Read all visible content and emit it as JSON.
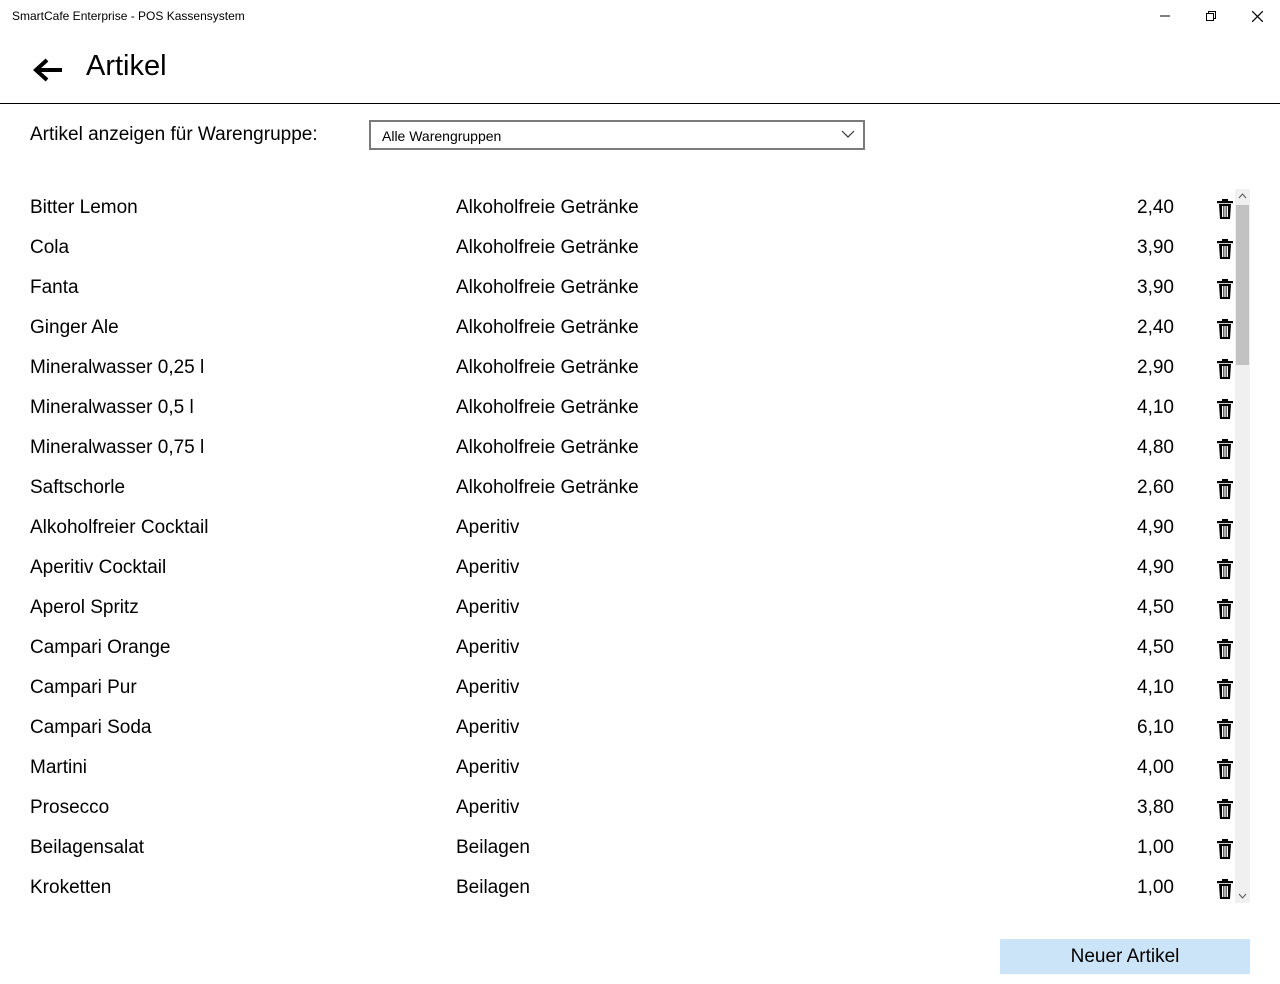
{
  "window": {
    "title": "SmartCafe Enterprise - POS Kassensystem"
  },
  "header": {
    "back_icon": "arrow-left-icon",
    "title": "Artikel"
  },
  "filter": {
    "label": "Artikel anzeigen für Warengruppe:",
    "selected": "Alle Warengruppen"
  },
  "articles": [
    {
      "name": "Bitter Lemon",
      "group": "Alkoholfreie Getränke",
      "price": "2,40"
    },
    {
      "name": "Cola",
      "group": "Alkoholfreie Getränke",
      "price": "3,90"
    },
    {
      "name": "Fanta",
      "group": "Alkoholfreie Getränke",
      "price": "3,90"
    },
    {
      "name": "Ginger Ale",
      "group": "Alkoholfreie Getränke",
      "price": "2,40"
    },
    {
      "name": "Mineralwasser 0,25 l",
      "group": "Alkoholfreie Getränke",
      "price": "2,90"
    },
    {
      "name": "Mineralwasser 0,5 l",
      "group": "Alkoholfreie Getränke",
      "price": "4,10"
    },
    {
      "name": "Mineralwasser 0,75 l",
      "group": "Alkoholfreie Getränke",
      "price": "4,80"
    },
    {
      "name": "Saftschorle",
      "group": "Alkoholfreie Getränke",
      "price": "2,60"
    },
    {
      "name": "Alkoholfreier Cocktail",
      "group": "Aperitiv",
      "price": "4,90"
    },
    {
      "name": "Aperitiv Cocktail",
      "group": "Aperitiv",
      "price": "4,90"
    },
    {
      "name": "Aperol Spritz",
      "group": "Aperitiv",
      "price": "4,50"
    },
    {
      "name": "Campari Orange",
      "group": "Aperitiv",
      "price": "4,50"
    },
    {
      "name": "Campari Pur",
      "group": "Aperitiv",
      "price": "4,10"
    },
    {
      "name": "Campari Soda",
      "group": "Aperitiv",
      "price": "6,10"
    },
    {
      "name": "Martini",
      "group": "Aperitiv",
      "price": "4,00"
    },
    {
      "name": "Prosecco",
      "group": "Aperitiv",
      "price": "3,80"
    },
    {
      "name": "Beilagensalat",
      "group": "Beilagen",
      "price": "1,00"
    },
    {
      "name": "Kroketten",
      "group": "Beilagen",
      "price": "1,00"
    }
  ],
  "actions": {
    "new_article": "Neuer Artikel"
  },
  "colors": {
    "button_bg": "#cce4f7",
    "scroll_thumb": "#c2c2c2",
    "scroll_track": "#f0f0f0"
  }
}
